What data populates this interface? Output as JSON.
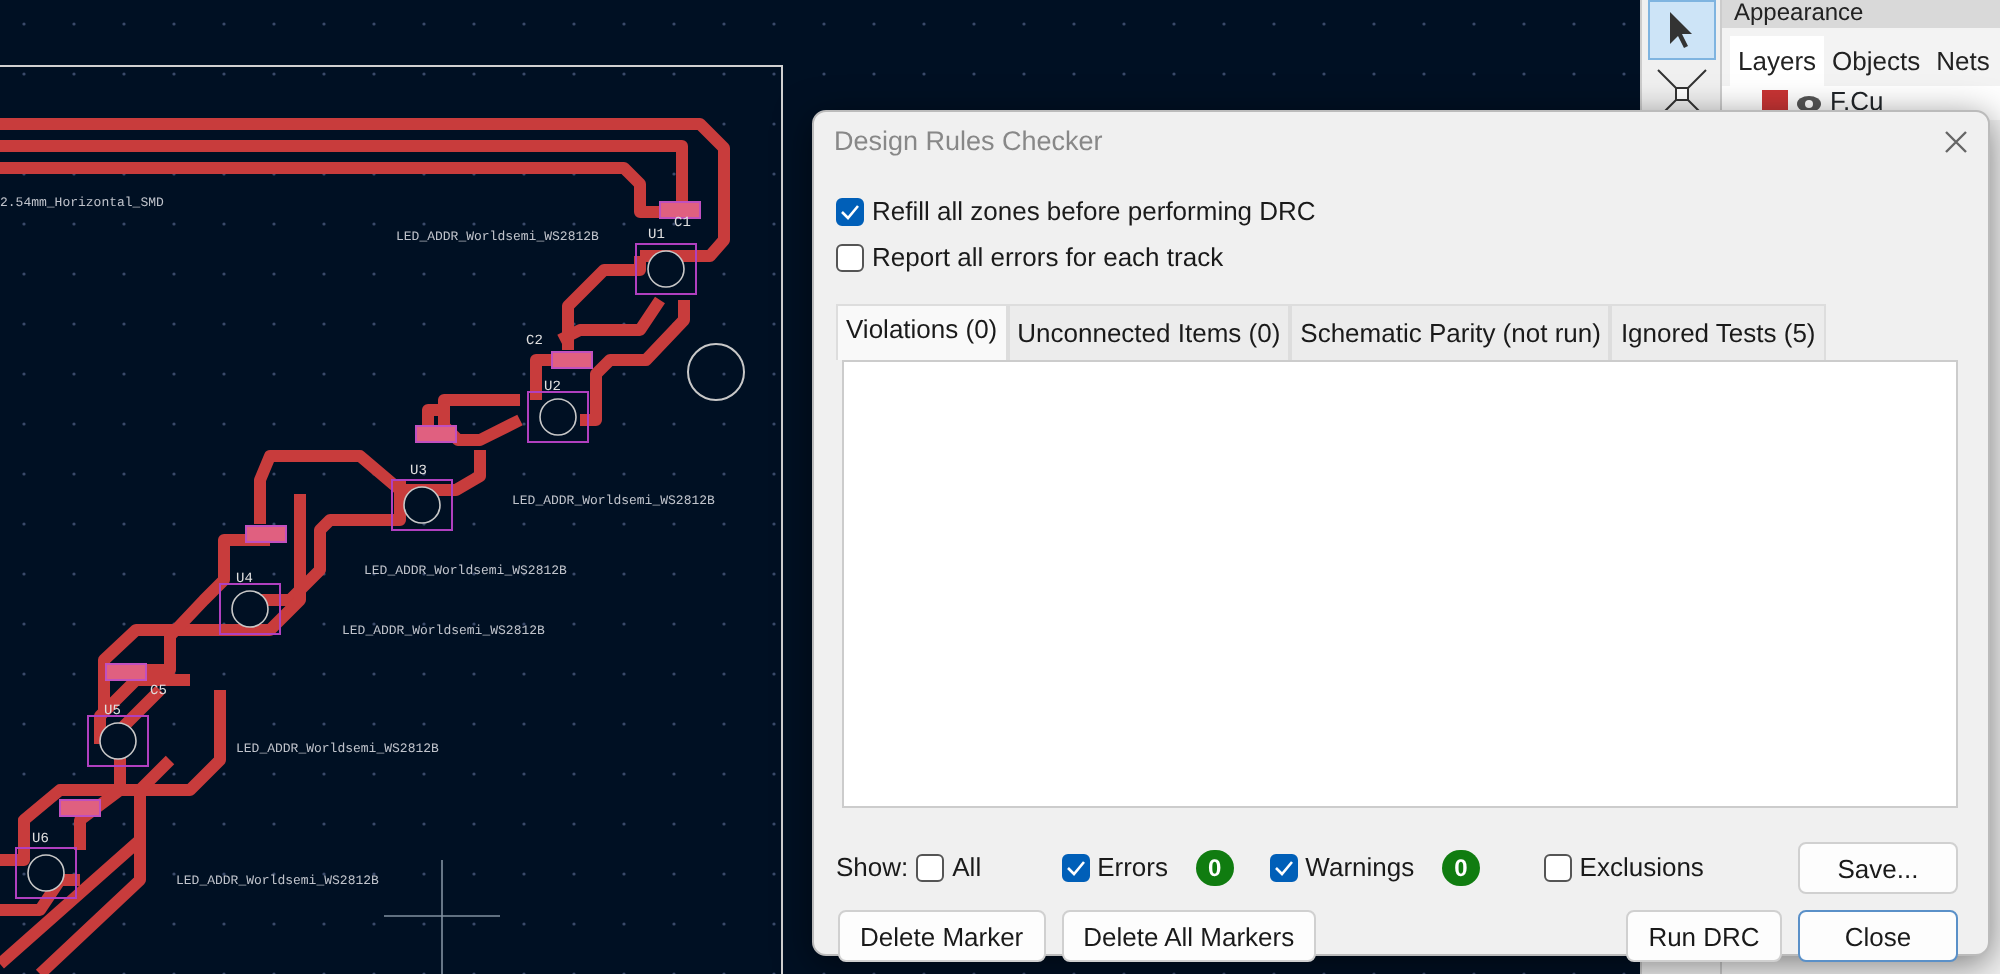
{
  "pcb_canvas": {
    "texts": [
      {
        "kind": "footprint",
        "text": "2.54mm_Horizontal_SMD"
      },
      {
        "kind": "footprint",
        "text": "LED_ADDR_Worldsemi_WS2812B"
      },
      {
        "kind": "footprint",
        "text": "LED_ADDR_Worldsemi_WS2812B"
      },
      {
        "kind": "footprint",
        "text": "LED_ADDR_Worldsemi_WS2812B"
      },
      {
        "kind": "footprint",
        "text": "LED_ADDR_Worldsemi_WS2812B"
      },
      {
        "kind": "footprint",
        "text": "LED_ADDR_Worldsemi_WS2812B"
      },
      {
        "kind": "footprint",
        "text": "LED_ADDR_Worldsemi_WS2812B"
      },
      {
        "kind": "reference",
        "text": "U1"
      },
      {
        "kind": "reference",
        "text": "U2"
      },
      {
        "kind": "reference",
        "text": "U3"
      },
      {
        "kind": "reference",
        "text": "U4"
      },
      {
        "kind": "reference",
        "text": "U5"
      },
      {
        "kind": "reference",
        "text": "U6"
      },
      {
        "kind": "reference",
        "text": "C1"
      },
      {
        "kind": "reference",
        "text": "C2"
      },
      {
        "kind": "reference",
        "text": "C5"
      }
    ]
  },
  "toolbar": {
    "tools": [
      {
        "kind": "select",
        "selected": true
      },
      {
        "kind": "route",
        "selected": false
      }
    ]
  },
  "appearance": {
    "title": "Appearance",
    "tabs": [
      {
        "label": "Layers",
        "selected": true
      },
      {
        "label": "Objects",
        "selected": false
      },
      {
        "label": "Nets",
        "selected": false
      }
    ],
    "layers": [
      {
        "name": "F.Cu",
        "color": "#c83434",
        "visible": true
      }
    ]
  },
  "dialog": {
    "title": "Design Rules Checker",
    "options": [
      {
        "label": "Refill all zones before performing DRC",
        "checked": true
      },
      {
        "label": "Report all errors for each track",
        "checked": false
      }
    ],
    "tabs": [
      {
        "label": "Violations (0)",
        "selected": true
      },
      {
        "label": "Unconnected Items (0)",
        "selected": false
      },
      {
        "label": "Schematic Parity (not run)",
        "selected": false
      },
      {
        "label": "Ignored Tests (5)",
        "selected": false
      }
    ],
    "show_label": "Show:",
    "filters": [
      {
        "label": "All",
        "checked": false
      },
      {
        "label": "Errors",
        "checked": true,
        "count": "0"
      },
      {
        "label": "Warnings",
        "checked": true,
        "count": "0"
      },
      {
        "label": "Exclusions",
        "checked": false
      }
    ],
    "save_button": "Save...",
    "left_buttons": [
      "Delete Marker",
      "Delete All Markers"
    ],
    "right_buttons": [
      {
        "label": "Run DRC",
        "selected": false
      },
      {
        "label": "Close",
        "selected": true
      }
    ]
  }
}
